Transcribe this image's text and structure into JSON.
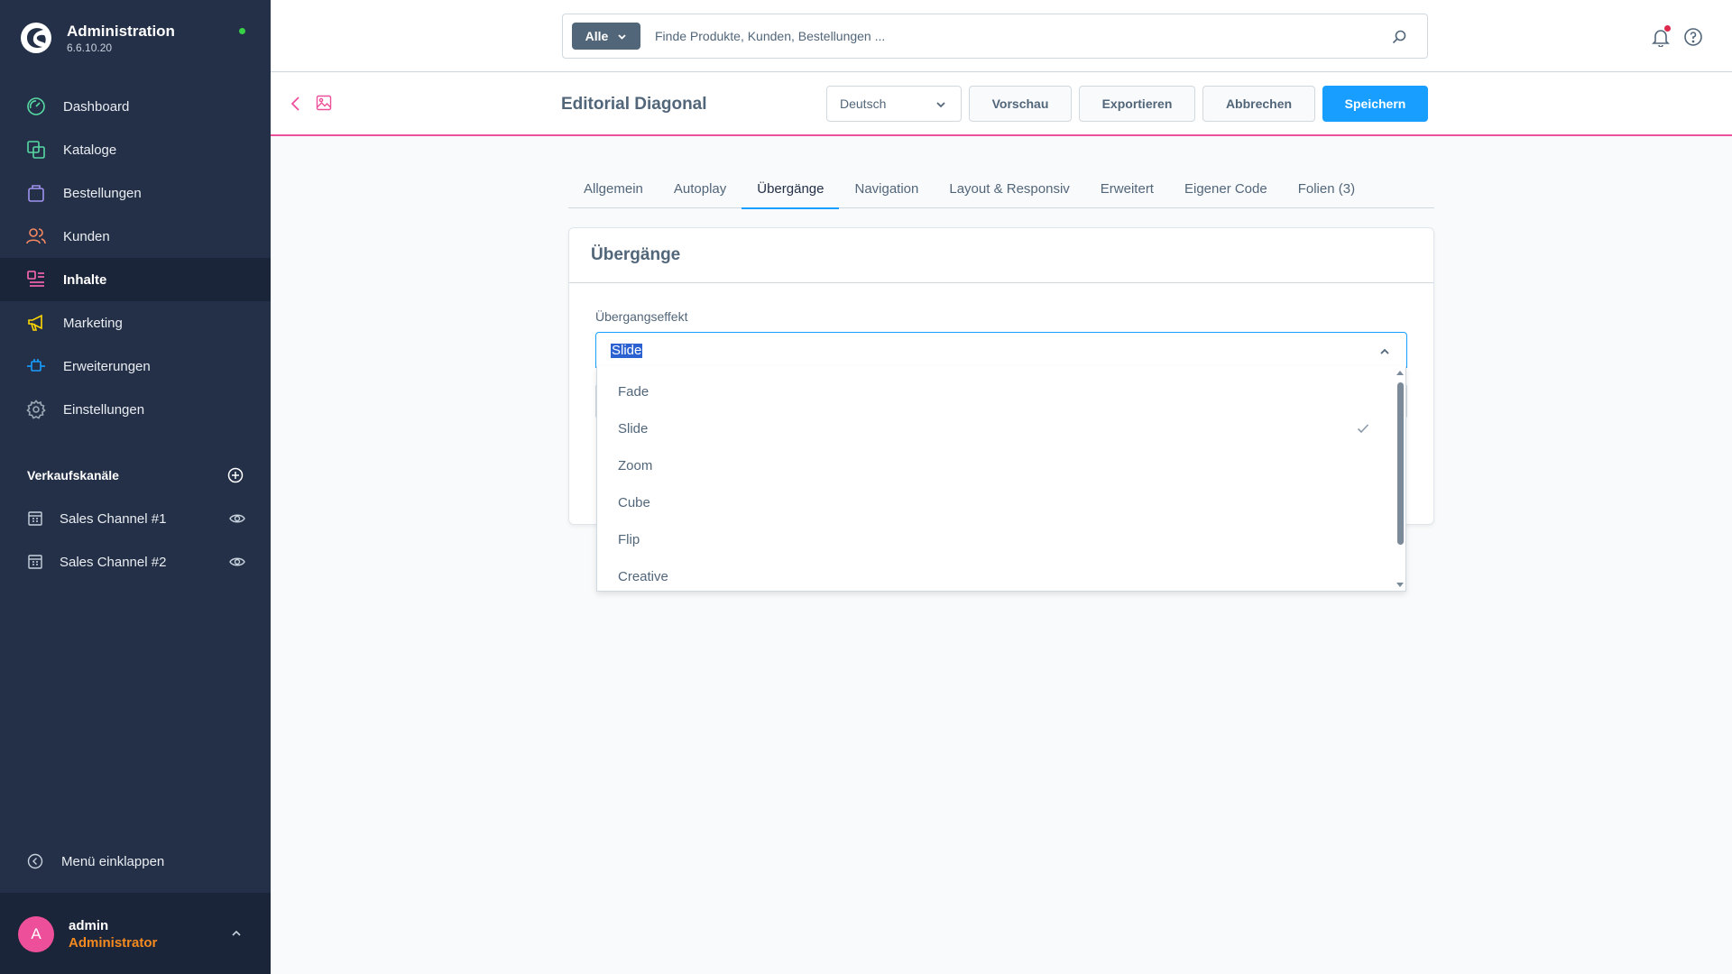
{
  "brand": {
    "title": "Administration",
    "version": "6.6.10.20"
  },
  "nav": [
    {
      "label": "Dashboard",
      "icon": "dashboard-icon",
      "color": "#57d9a3"
    },
    {
      "label": "Kataloge",
      "icon": "catalog-icon",
      "color": "#57d9a3"
    },
    {
      "label": "Bestellungen",
      "icon": "orders-icon",
      "color": "#a092f0"
    },
    {
      "label": "Kunden",
      "icon": "customers-icon",
      "color": "#f88962"
    },
    {
      "label": "Inhalte",
      "icon": "content-icon",
      "color": "#ff68b4",
      "active": true
    },
    {
      "label": "Marketing",
      "icon": "marketing-icon",
      "color": "#ffd700"
    },
    {
      "label": "Erweiterungen",
      "icon": "extensions-icon",
      "color": "#189eff"
    },
    {
      "label": "Einstellungen",
      "icon": "settings-icon",
      "color": "#9aa8b5"
    }
  ],
  "sales_channels": {
    "heading": "Verkaufskanäle",
    "items": [
      {
        "label": "Sales Channel #1"
      },
      {
        "label": "Sales Channel #2"
      }
    ]
  },
  "collapse_label": "Menü einklappen",
  "user": {
    "initial": "A",
    "name": "admin",
    "role": "Administrator"
  },
  "search": {
    "type_label": "Alle",
    "placeholder": "Finde Produkte, Kunden, Bestellungen ..."
  },
  "smartbar": {
    "title": "Editorial Diagonal",
    "language": "Deutsch",
    "preview_label": "Vorschau",
    "export_label": "Exportieren",
    "cancel_label": "Abbrechen",
    "save_label": "Speichern"
  },
  "tabs": [
    {
      "label": "Allgemein"
    },
    {
      "label": "Autoplay"
    },
    {
      "label": "Übergänge",
      "active": true
    },
    {
      "label": "Navigation"
    },
    {
      "label": "Layout & Responsiv"
    },
    {
      "label": "Erweitert"
    },
    {
      "label": "Eigener Code"
    },
    {
      "label": "Folien (3)"
    }
  ],
  "card": {
    "title": "Übergänge",
    "field_label": "Übergangseffekt",
    "selected_value": "Slide",
    "options": [
      {
        "label": "Fade"
      },
      {
        "label": "Slide",
        "selected": true
      },
      {
        "label": "Zoom"
      },
      {
        "label": "Cube"
      },
      {
        "label": "Flip"
      },
      {
        "label": "Creative"
      }
    ]
  },
  "colors": {
    "sidebar": "#243047",
    "accent": "#189eff",
    "brand_pink": "#ee4f9a",
    "role": "#f58a1f"
  }
}
